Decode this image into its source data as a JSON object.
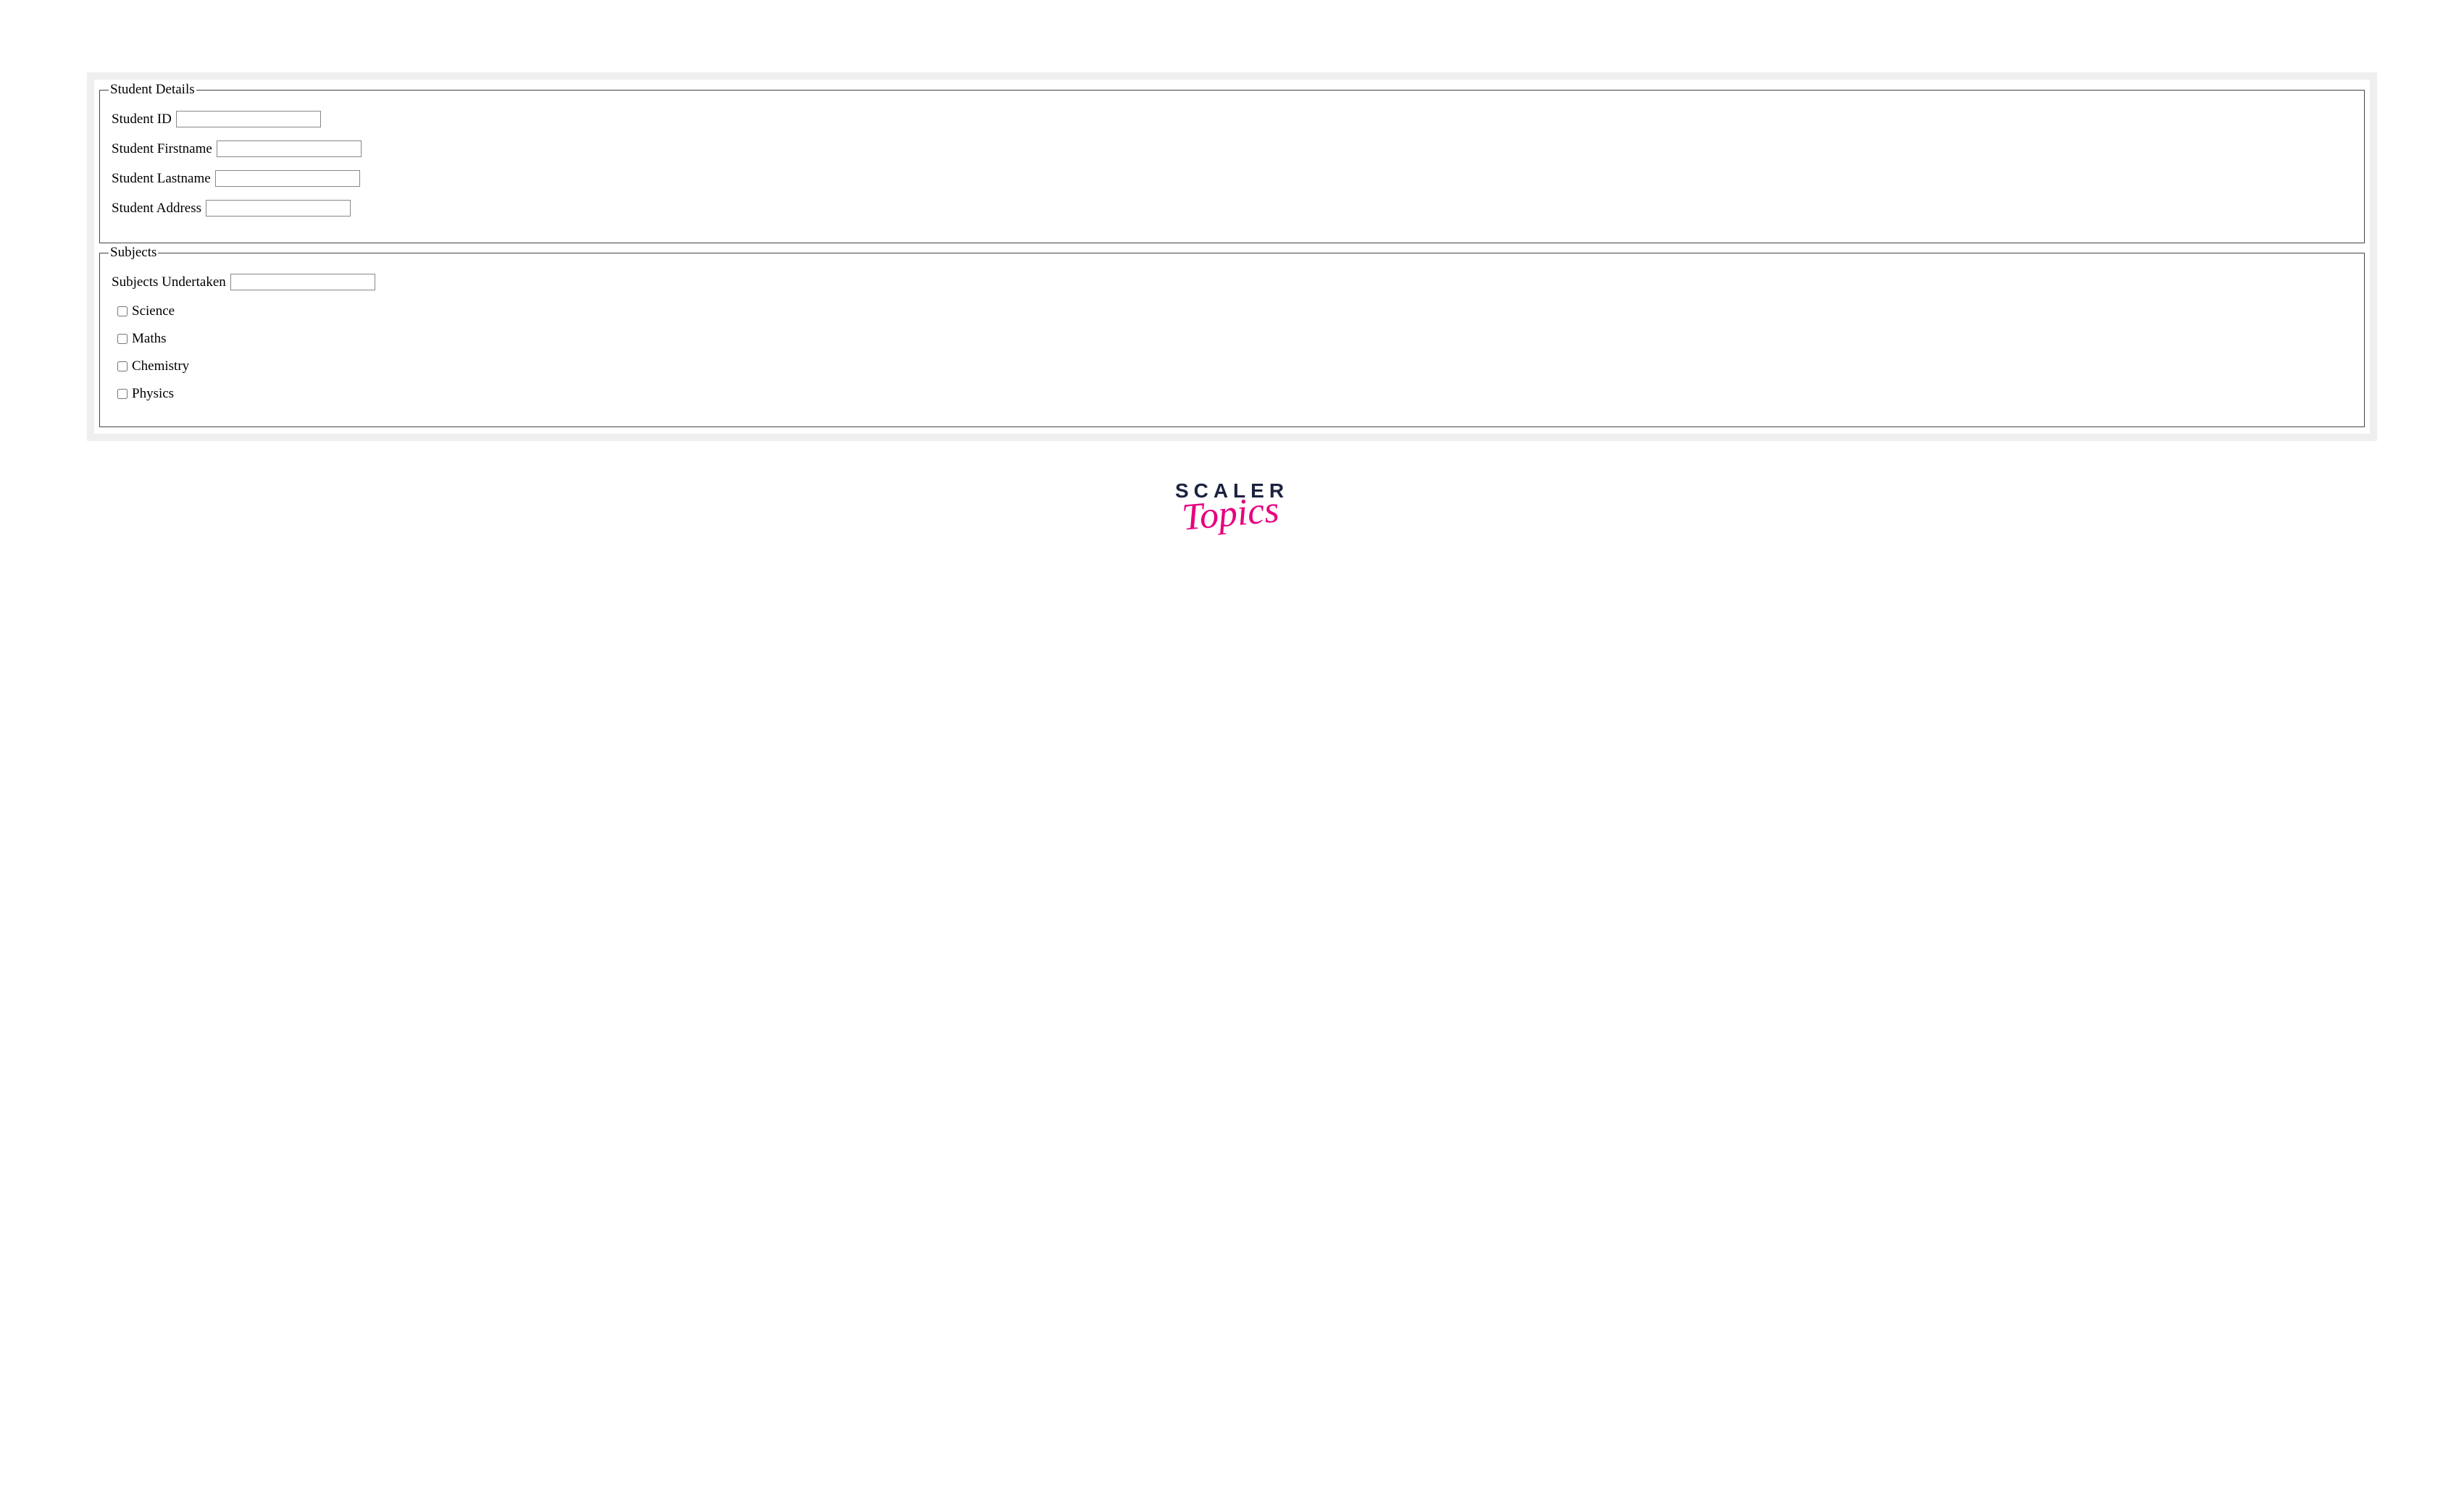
{
  "form": {
    "studentDetails": {
      "legend": "Student Details",
      "fields": [
        {
          "label": "Student ID",
          "value": ""
        },
        {
          "label": "Student Firstname",
          "value": ""
        },
        {
          "label": "Student Lastname",
          "value": ""
        },
        {
          "label": "Student Address",
          "value": ""
        }
      ]
    },
    "subjects": {
      "legend": "Subjects",
      "undertaken": {
        "label": "Subjects Undertaken",
        "value": ""
      },
      "options": [
        {
          "label": "Science",
          "checked": false
        },
        {
          "label": "Maths",
          "checked": false
        },
        {
          "label": "Chemistry",
          "checked": false
        },
        {
          "label": "Physics",
          "checked": false
        }
      ]
    }
  },
  "logo": {
    "line1": "SCALER",
    "line2": "Topics"
  }
}
